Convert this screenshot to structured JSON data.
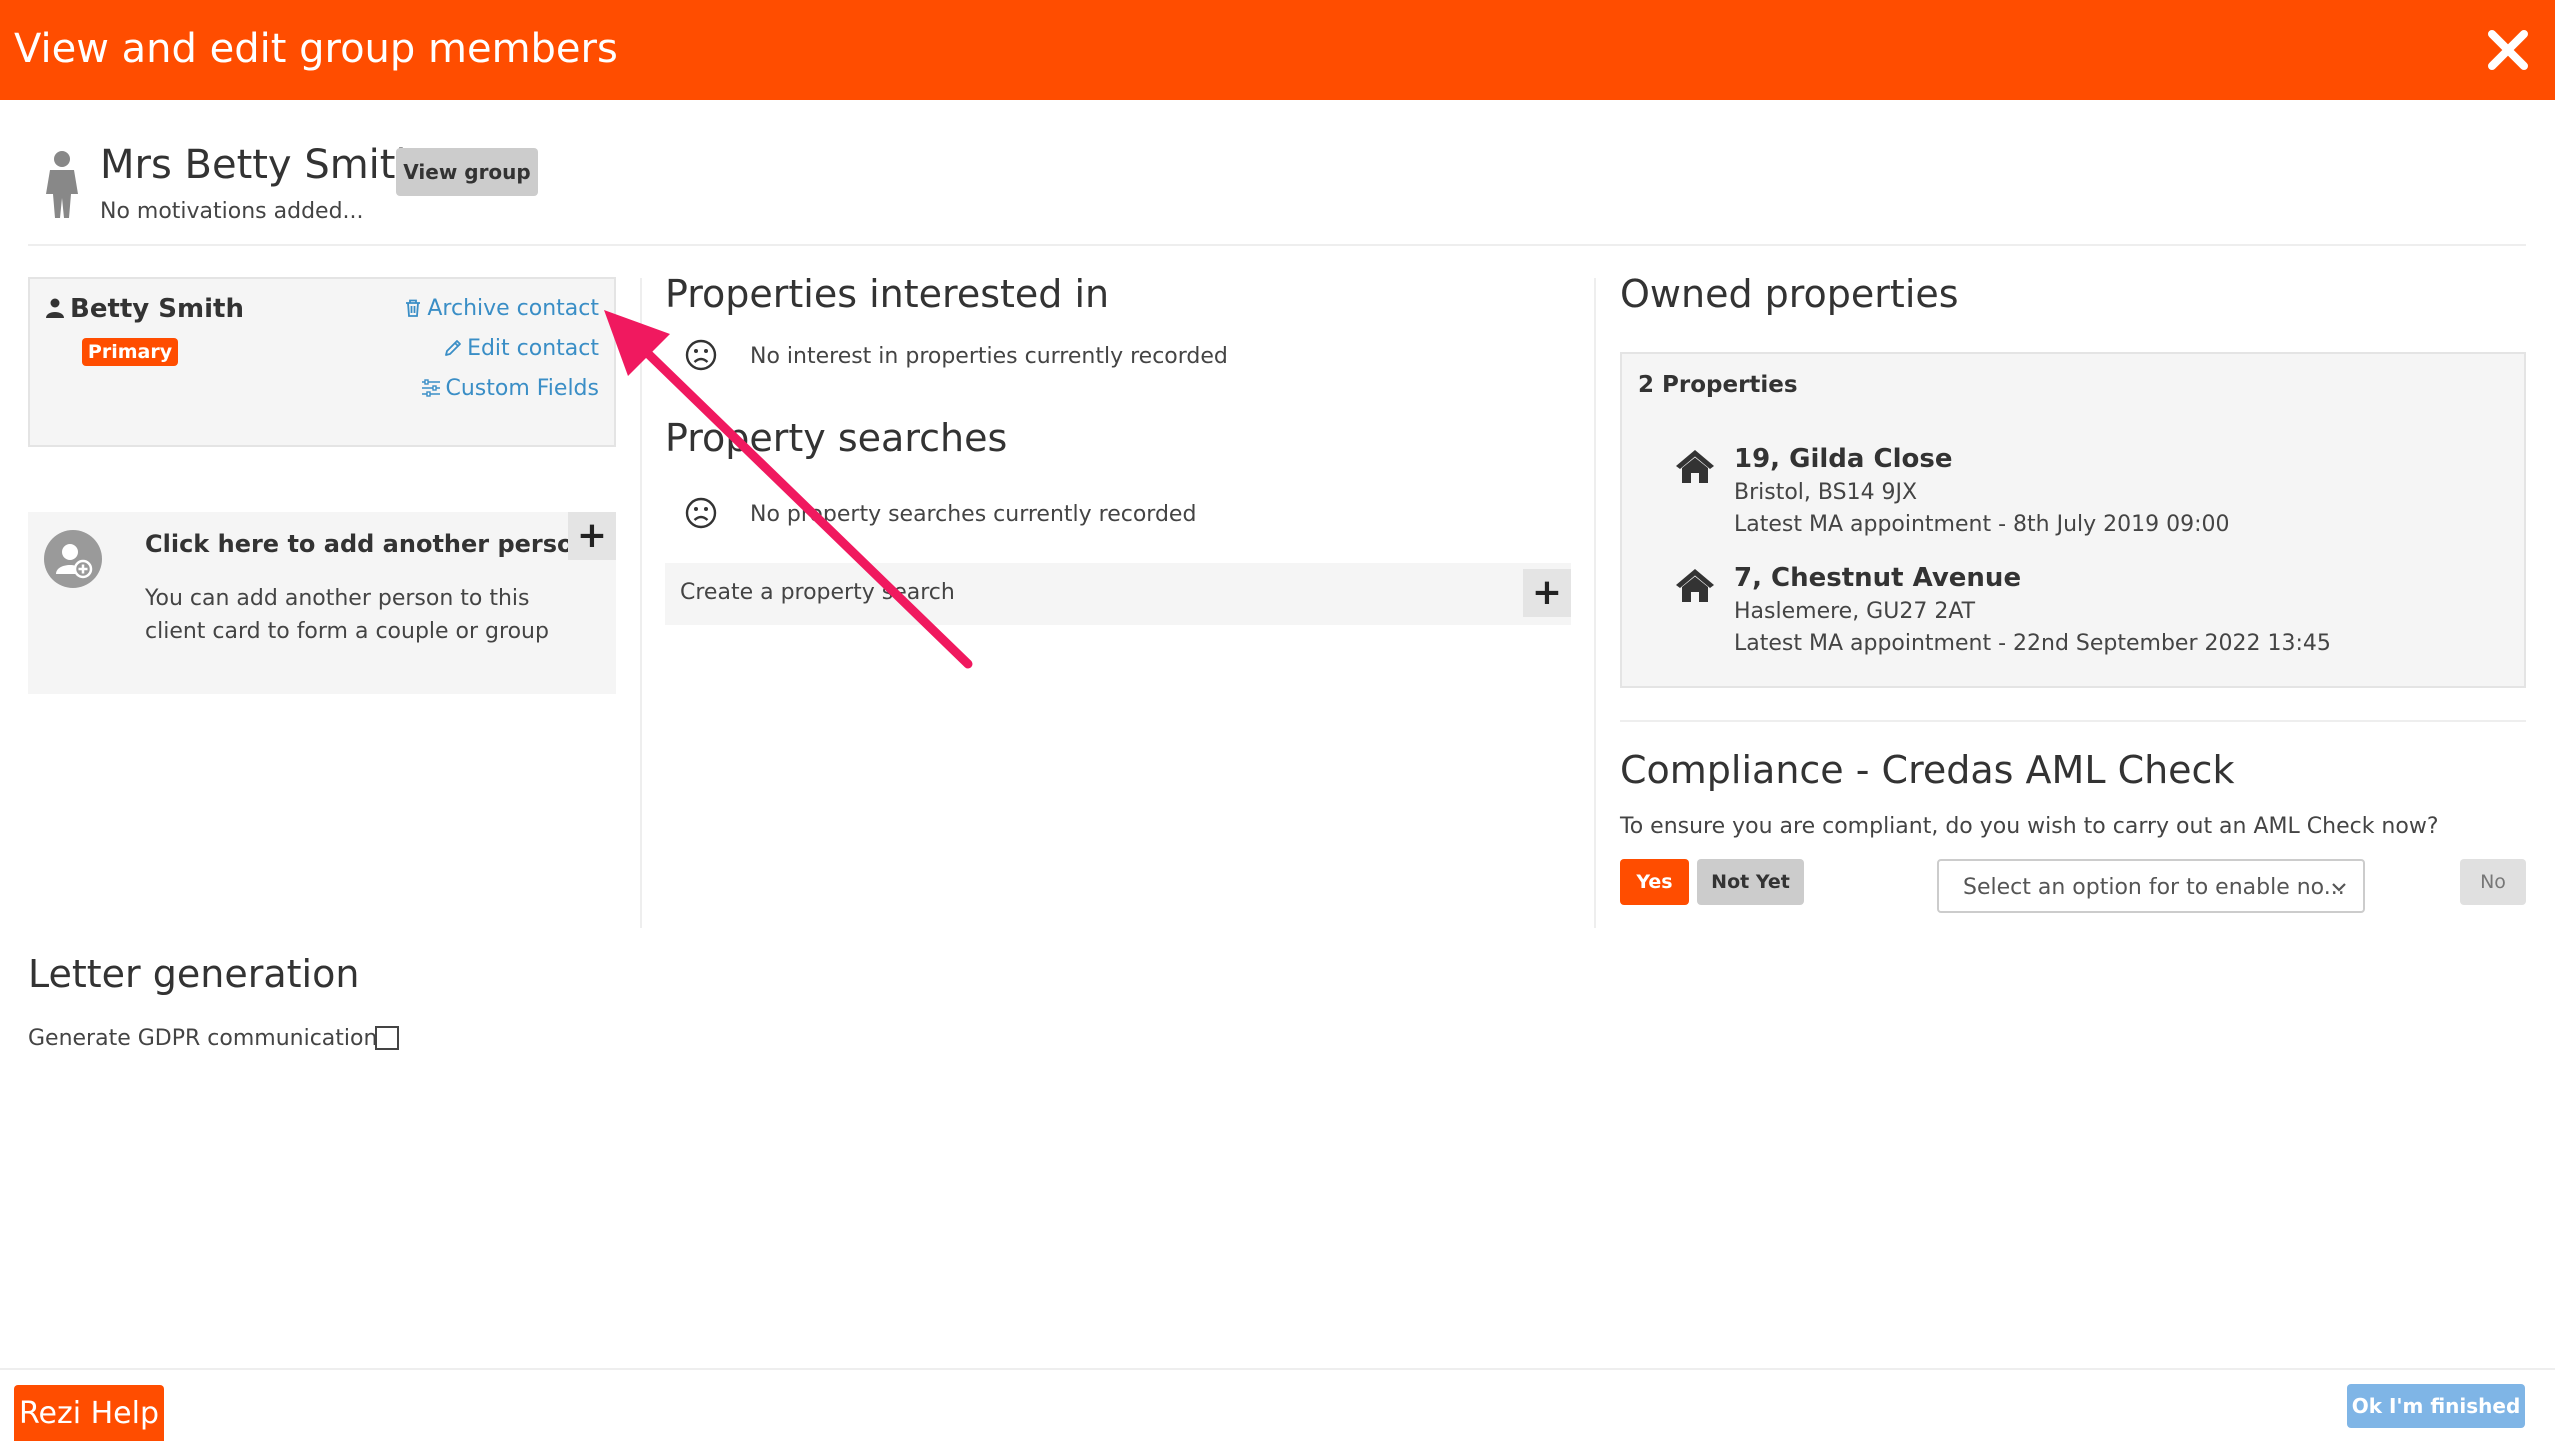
{
  "header": {
    "title": "View and edit group members"
  },
  "person": {
    "name": "Mrs Betty Smith",
    "view_group_label": "View group",
    "motivations": "No motivations added..."
  },
  "contact": {
    "name": "Betty Smith",
    "badge": "Primary",
    "archive_label": "Archive contact",
    "edit_label": "Edit contact",
    "custom_fields_label": "Custom Fields"
  },
  "add_person": {
    "title": "Click here to add another person",
    "description": "You can add another person to this client card to form a couple or group"
  },
  "interested": {
    "heading": "Properties interested in",
    "empty_text": "No interest in properties currently recorded"
  },
  "searches": {
    "heading": "Property searches",
    "empty_text": "No property searches currently recorded",
    "create_label": "Create a property search"
  },
  "owned": {
    "heading": "Owned properties",
    "count_label": "2 Properties",
    "properties": [
      {
        "address": "19, Gilda Close",
        "location": "Bristol, BS14 9JX",
        "appointment": "Latest MA appointment - 8th July 2019 09:00"
      },
      {
        "address": "7, Chestnut Avenue",
        "location": "Haslemere, GU27 2AT",
        "appointment": "Latest MA appointment - 22nd September 2022 13:45"
      }
    ]
  },
  "compliance": {
    "heading": "Compliance - Credas AML Check",
    "question": "To ensure you are compliant, do you wish to carry out an AML Check now?",
    "yes_label": "Yes",
    "not_yet_label": "Not Yet",
    "select_placeholder": "Select an option for to enable no...",
    "no_label": "No"
  },
  "letters": {
    "heading": "Letter generation",
    "gdpr_label": "Generate GDPR communication:"
  },
  "footer": {
    "help_label": "Rezi Help",
    "finished_label": "Ok I'm finished"
  },
  "colors": {
    "brand": "#ff4d00",
    "link": "#3a8ec6",
    "finished_button": "#7fb5e6",
    "annotation_arrow": "#f0195f"
  },
  "icons": {
    "close": "close-icon",
    "person": "person-silhouette-icon",
    "user": "user-icon",
    "archive": "trash-icon",
    "edit": "pencil-icon",
    "custom_fields": "sliders-icon",
    "add_person": "add-user-icon",
    "empty": "sad-face-icon",
    "house": "house-icon",
    "chevron": "chevron-down-icon"
  }
}
